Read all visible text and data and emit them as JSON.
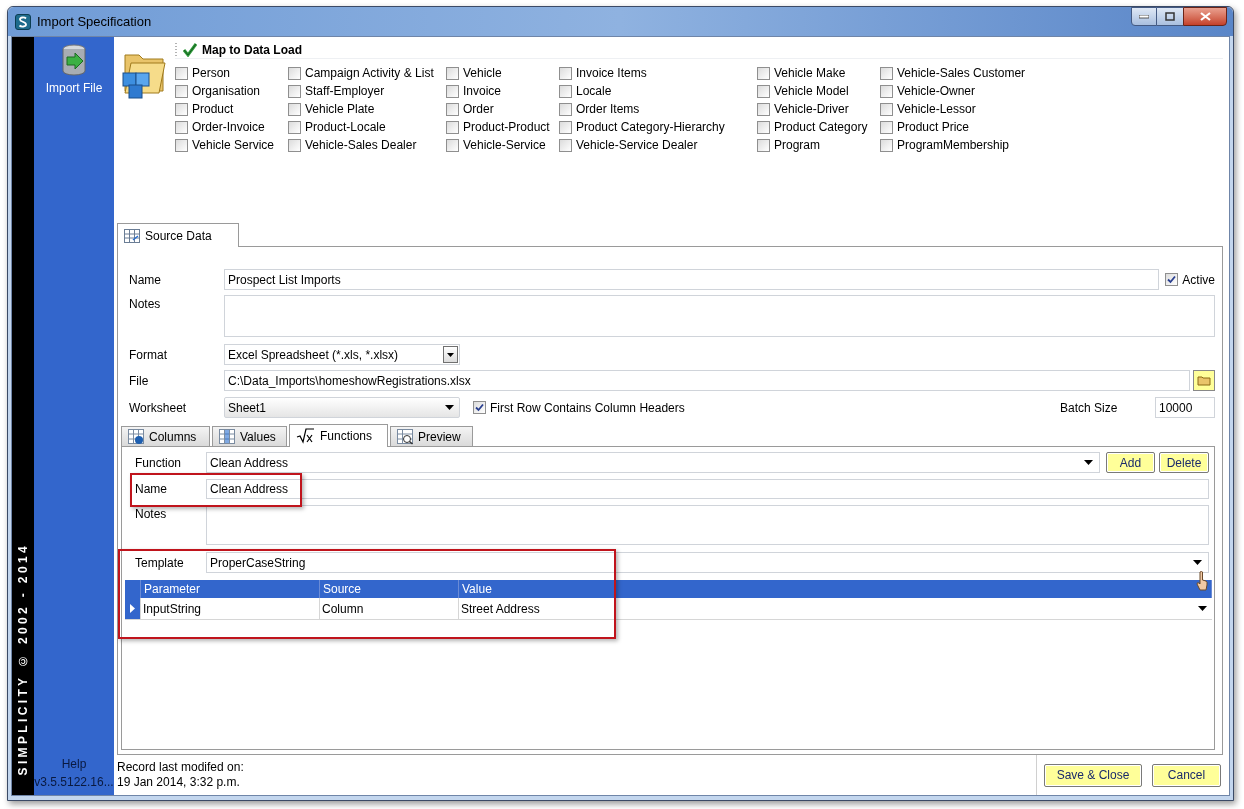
{
  "window": {
    "title": "Import Specification"
  },
  "sidebar": {
    "items": [
      {
        "label": "Import File"
      }
    ],
    "vertical_text": "SIMPLICITY © 2002 - 2014",
    "help": "Help",
    "version": "v3.5.5122.16..."
  },
  "map_section": {
    "title": "Map to Data Load",
    "columns": [
      [
        {
          "label": "Person",
          "checked": false
        },
        {
          "label": "Organisation",
          "checked": false
        },
        {
          "label": "Product",
          "checked": false
        },
        {
          "label": "Order-Invoice",
          "checked": false
        },
        {
          "label": "Vehicle Service",
          "checked": false
        }
      ],
      [
        {
          "label": "Campaign Activity & List",
          "checked": false
        },
        {
          "label": "Staff-Employer",
          "checked": false
        },
        {
          "label": "Vehicle Plate",
          "checked": false
        },
        {
          "label": "Product-Locale",
          "checked": false
        },
        {
          "label": "Vehicle-Sales Dealer",
          "checked": false
        }
      ],
      [
        {
          "label": "Vehicle",
          "checked": false
        },
        {
          "label": "Invoice",
          "checked": false
        },
        {
          "label": "Order",
          "checked": false
        },
        {
          "label": "Product-Product",
          "checked": false
        },
        {
          "label": "Vehicle-Service",
          "checked": false
        }
      ],
      [
        {
          "label": "Invoice Items",
          "checked": false
        },
        {
          "label": "Locale",
          "checked": false
        },
        {
          "label": "Order Items",
          "checked": false
        },
        {
          "label": "Product Category-Hierarchy",
          "checked": false
        },
        {
          "label": "Vehicle-Service Dealer",
          "checked": false
        }
      ],
      [
        {
          "label": "Vehicle Make",
          "checked": false
        },
        {
          "label": "Vehicle Model",
          "checked": false
        },
        {
          "label": "Vehicle-Driver",
          "checked": false
        },
        {
          "label": "Product Category",
          "checked": false
        },
        {
          "label": "Program",
          "checked": false
        }
      ],
      [
        {
          "label": "Vehicle-Sales Customer",
          "checked": false
        },
        {
          "label": "Vehicle-Owner",
          "checked": false
        },
        {
          "label": "Vehicle-Lessor",
          "checked": false
        },
        {
          "label": "Product Price",
          "checked": false
        },
        {
          "label": "ProgramMembership",
          "checked": false
        }
      ]
    ]
  },
  "main_tabs": [
    {
      "label": "Source Data",
      "selected": true
    }
  ],
  "form": {
    "name_label": "Name",
    "name_value": "Prospect List Imports",
    "active": {
      "label": "Active",
      "checked": true
    },
    "notes_label": "Notes",
    "format_label": "Format",
    "format_value": "Excel Spreadsheet (*.xls, *.xlsx)",
    "file_label": "File",
    "file_value": "C:\\Data_Imports\\homeshowRegistrations.xlsx",
    "worksheet_label": "Worksheet",
    "worksheet_value": "Sheet1",
    "first_row": {
      "label": "First Row Contains Column Headers",
      "checked": true
    },
    "batch_label": "Batch Size",
    "batch_value": "10000"
  },
  "sub_tabs": [
    {
      "label": "Columns",
      "selected": false,
      "kind": "columns"
    },
    {
      "label": "Values",
      "selected": false,
      "kind": "values"
    },
    {
      "label": "Functions",
      "selected": true,
      "kind": "functions"
    },
    {
      "label": "Preview",
      "selected": false,
      "kind": "preview"
    }
  ],
  "functions": {
    "function_label": "Function",
    "function_value": "Clean Address",
    "add": "Add",
    "delete": "Delete",
    "name_label": "Name",
    "name_value": "Clean Address",
    "notes_label": "Notes",
    "template_label": "Template",
    "template_value": "ProperCaseString",
    "grid": {
      "columns": [
        "Parameter",
        "Source",
        "Value"
      ],
      "rows": [
        {
          "cells": [
            "InputString",
            "Column",
            "Street Address"
          ],
          "current": true
        }
      ]
    }
  },
  "footer": {
    "record_label": "Record last modifed on:",
    "record_date": "19 Jan 2014, 3:32 p.m.",
    "buttons": [
      "Save & Close",
      "Cancel"
    ]
  }
}
